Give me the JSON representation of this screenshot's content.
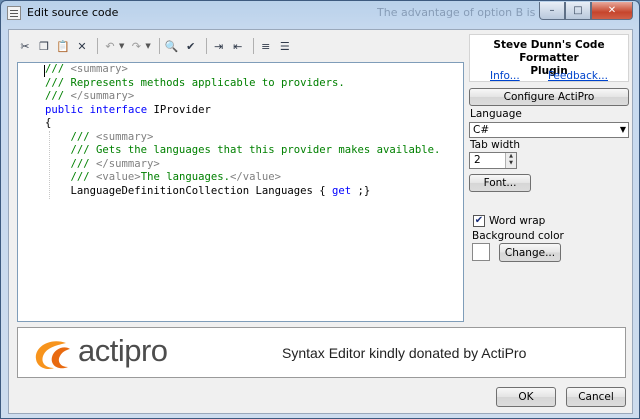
{
  "window": {
    "title": "Edit source code",
    "background_title": "The advantage of option B is that you",
    "caption": {
      "minimize": "–",
      "maximize": "□",
      "close": "✕"
    }
  },
  "toolbar": {
    "icons": [
      "cut-icon",
      "copy-icon",
      "paste-icon",
      "delete-icon",
      "undo-icon",
      "redo-icon",
      "find-icon",
      "spellcheck-icon",
      "indent-icon",
      "outdent-icon",
      "comment-icon",
      "uncomment-icon"
    ]
  },
  "editor": {
    "lines": [
      {
        "parts": [
          {
            "t": "///",
            "c": "cmt"
          },
          {
            "t": " <summary>",
            "c": "doc"
          }
        ]
      },
      {
        "parts": [
          {
            "t": "/// Represents methods applicable to providers.",
            "c": "cmt"
          }
        ]
      },
      {
        "parts": [
          {
            "t": "///",
            "c": "cmt"
          },
          {
            "t": " </summary>",
            "c": "doc"
          }
        ]
      },
      {
        "parts": [
          {
            "t": "public",
            "c": "kw"
          },
          {
            "t": " ",
            "c": "pl"
          },
          {
            "t": "interface",
            "c": "kw"
          },
          {
            "t": " IProvider",
            "c": "pl"
          }
        ]
      },
      {
        "parts": [
          {
            "t": "{",
            "c": "pl"
          }
        ]
      },
      {
        "parts": [
          {
            "t": "    ///",
            "c": "cmt"
          },
          {
            "t": " <summary>",
            "c": "doc"
          }
        ]
      },
      {
        "parts": [
          {
            "t": "    /// Gets the languages that this provider makes available.",
            "c": "cmt"
          }
        ]
      },
      {
        "parts": [
          {
            "t": "    ///",
            "c": "cmt"
          },
          {
            "t": " </summary>",
            "c": "doc"
          }
        ]
      },
      {
        "parts": [
          {
            "t": "    ///",
            "c": "cmt"
          },
          {
            "t": " <value>",
            "c": "doc"
          },
          {
            "t": "The languages.",
            "c": "cmt"
          },
          {
            "t": "</value>",
            "c": "doc"
          }
        ]
      },
      {
        "parts": [
          {
            "t": "    LanguageDefinitionCollection Languages { ",
            "c": "pl"
          },
          {
            "t": "get",
            "c": "kw"
          },
          {
            "t": " ;}",
            "c": "pl"
          }
        ]
      }
    ]
  },
  "plugin": {
    "name_line1": "Steve Dunn's Code Formatter",
    "name_line2": "Plugin",
    "info_link": "Info...",
    "feedback_link": "Feedback..."
  },
  "settings": {
    "configure_button": "Configure ActiPro",
    "language_label": "Language",
    "language_value": "C#",
    "tab_width_label": "Tab width",
    "tab_width_value": "2",
    "font_button": "Font...",
    "word_wrap_label": "Word wrap",
    "word_wrap_checked": true,
    "background_color_label": "Background color",
    "change_button": "Change..."
  },
  "banner": {
    "logo_text": "actipro",
    "credit_text": "Syntax Editor kindly donated by ActiPro"
  },
  "footer": {
    "ok_button": "OK",
    "cancel_button": "Cancel"
  }
}
